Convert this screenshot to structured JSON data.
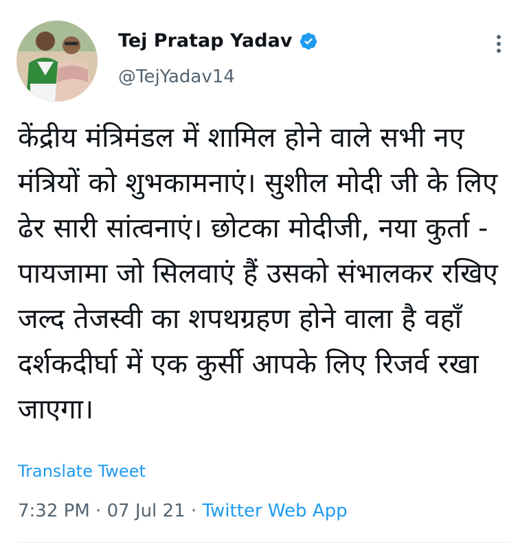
{
  "author": {
    "display_name": "Tej Pratap Yadav",
    "handle": "@TejYadav14",
    "verified": true
  },
  "tweet": {
    "text": "केंद्रीय मंत्रिमंडल में शामिल होने वाले सभी नए मंत्रियों को शुभकामनाएं। सुशील मोदी जी के लिए ढेर सारी सांत्वनाएं। छोटका मोदीजी, नया कुर्ता - पायजामा जो सिलवाएं हैं उसको संभालकर रखिए जल्द तेजस्वी का शपथग्रहण होने वाला है वहाँ दर्शकदीर्घा में एक कुर्सी आपके लिए रिजर्व रखा जाएगा।",
    "translate_label": "Translate Tweet",
    "time": "7:32 PM",
    "date": "07 Jul 21",
    "source": "Twitter Web App",
    "separator": "·"
  },
  "colors": {
    "accent": "#1d9bf0",
    "secondary_text": "#536471",
    "primary_text": "#0f1419"
  },
  "icons": {
    "verified": "verified-badge-icon",
    "more": "more-vertical-icon"
  }
}
